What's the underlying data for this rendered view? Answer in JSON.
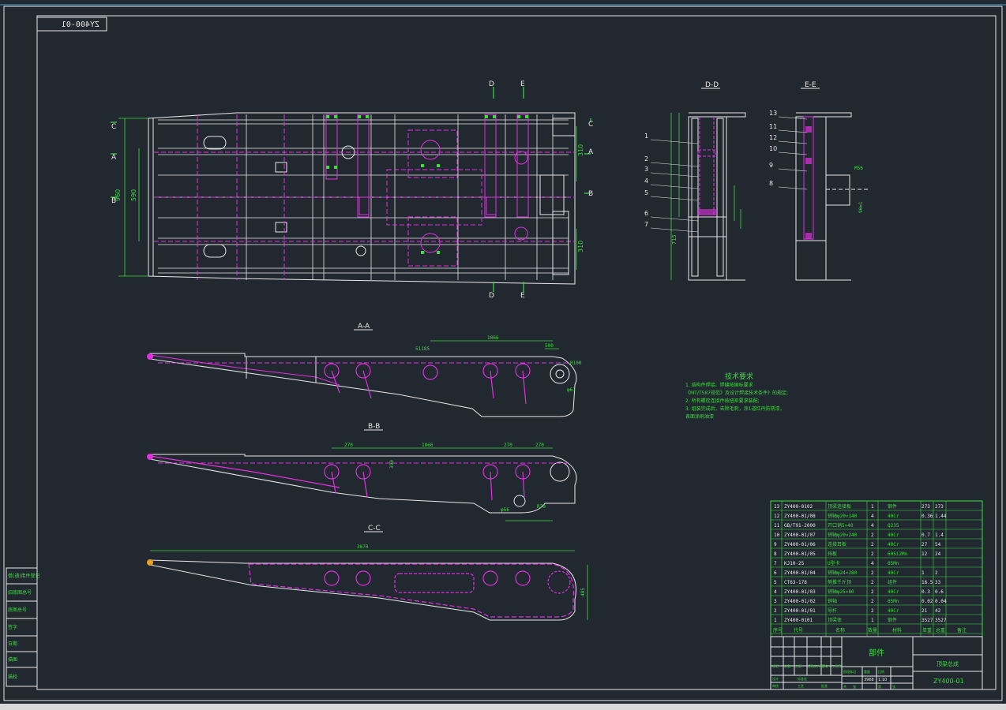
{
  "drawing_code_box": "ZY400-01",
  "views": {
    "plan_section_marks": [
      "D",
      "E"
    ],
    "dd_title": "D-D",
    "ee_title": "E-E",
    "aa_title": "A-A",
    "bb_title": "B-B",
    "cc_title": "C-C",
    "side_marks": [
      "A",
      "B",
      "C"
    ]
  },
  "dims": {
    "aa_1066": "1066",
    "aa_500": "500",
    "aa_r100": "R100",
    "aa_phi61": "φ61",
    "aa_51185": "51185",
    "bb_270a": "270",
    "bb_1066": "1066",
    "bb_270b": "270",
    "bb_270c": "270",
    "bb_390": "390",
    "bb_phi56": "φ56",
    "bb_r70": "R70",
    "cc_3670": "3670",
    "cc_485": "485",
    "plan_960": "960",
    "plan_590": "590",
    "plan_310": "310",
    "plan_310b": "310",
    "dd_715": "715",
    "dd_ee_56": "M56",
    "ee_90": "90±1"
  },
  "balloons_dd": [
    "1",
    "2",
    "3",
    "4",
    "5",
    "6",
    "7"
  ],
  "balloons_ee": [
    "13",
    "11",
    "12",
    "10",
    "9",
    "8"
  ],
  "notes": {
    "title": "技术要求",
    "lines": [
      "1. 结构件焊接、焊缝按国标要求",
      "  《MT/T587规范》及设计焊接技术条件》的规定;",
      "2. 所有螺栓连接件按扭矩要求装配;",
      "3. 组装完成后，去除毛刺，涂1道红丹防锈漆，",
      "   表面涂刷油漆"
    ]
  },
  "bom": {
    "rows": [
      [
        "13",
        "ZY400-0102",
        "顶梁连接板",
        "1",
        "钢件",
        "273",
        "273"
      ],
      [
        "12",
        "ZY400-01/08",
        "销轴φ20×140",
        "4",
        "40Cr",
        "0.36",
        "1.44"
      ],
      [
        "11",
        "GB/T91-2000",
        "开口销5×40",
        "4",
        "Q235",
        "",
        ""
      ],
      [
        "10",
        "ZY400-01/07",
        "销轴φ20×240",
        "2",
        "40Cr",
        "0.7",
        "1.4"
      ],
      [
        "9",
        "ZY400-01/06",
        "连接耳板",
        "2",
        "40Cr",
        "27",
        "54"
      ],
      [
        "8",
        "ZY400-01/05",
        "挡板",
        "2",
        "60Si2Mn",
        "12",
        "24"
      ],
      [
        "7",
        "KJ10-25",
        "U型卡",
        "4",
        "65Mn",
        "",
        ""
      ],
      [
        "6",
        "ZY400-01/04",
        "销轴φ24×280",
        "2",
        "40Cr",
        "1",
        "2"
      ],
      [
        "5",
        "CT63-178",
        "侧推千斤顶",
        "2",
        "组件",
        "16.5",
        "33"
      ],
      [
        "4",
        "ZY400-01/03",
        "销轴φ25×80",
        "2",
        "40Cr",
        "0.3",
        "0.6"
      ],
      [
        "3",
        "ZY400-01/02",
        "销轴",
        "2",
        "65Mn",
        "0.02",
        "0.04"
      ],
      [
        "2",
        "ZY400-01/01",
        "导杆",
        "2",
        "40Cr",
        "21",
        "42"
      ],
      [
        "1",
        "ZY400-0101",
        "顶梁体",
        "1",
        "钢件",
        "3527",
        "3527"
      ]
    ],
    "header": [
      "序号",
      "代号",
      "名称",
      "数量",
      "材料",
      "单重",
      "总重",
      "备注"
    ]
  },
  "title_block": {
    "part_name": "部件",
    "assembly_name": "顶梁总成",
    "drawing_number": "ZY400-01",
    "scale": "1:10",
    "weight": "3968",
    "labels": [
      "标记",
      "处数",
      "分区",
      "更改文件号",
      "签名",
      "年月日",
      "设计",
      "标准化",
      "阶段标记",
      "重量",
      "比例",
      "审核",
      "工艺",
      "批准",
      "共",
      "张",
      "第",
      "张"
    ]
  },
  "left_strip": [
    "借(通)用件登记",
    "旧底图总号",
    "底图总号",
    "签字",
    "日期",
    "描图",
    "描校"
  ]
}
